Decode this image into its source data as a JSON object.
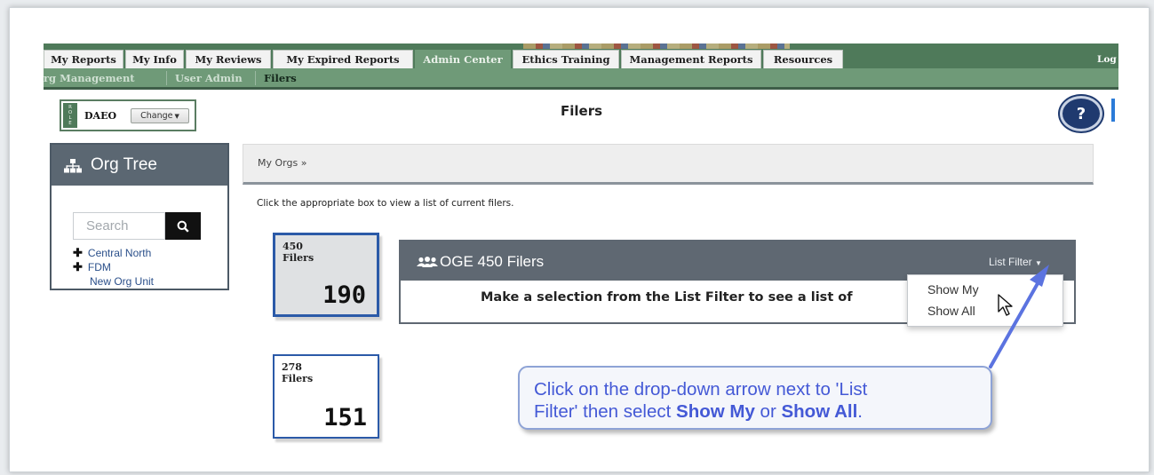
{
  "topnav": {
    "tabs": [
      {
        "label": "My Reports"
      },
      {
        "label": "My Info"
      },
      {
        "label": "My Reviews"
      },
      {
        "label": "My Expired Reports"
      },
      {
        "label": "Admin Center"
      },
      {
        "label": "Ethics Training"
      },
      {
        "label": "Management Reports"
      },
      {
        "label": "Resources"
      }
    ],
    "logout": "Log Out"
  },
  "subnav": {
    "items": [
      {
        "label": "rg Management"
      },
      {
        "label": "User Admin"
      },
      {
        "label": "Filers"
      }
    ]
  },
  "role": {
    "strip": "ROLE",
    "name": "DAEO",
    "change_label": "Change"
  },
  "page": {
    "title": "Filers",
    "help": "?"
  },
  "org_tree": {
    "title": "Org Tree",
    "search_placeholder": "Search",
    "items": [
      {
        "label": "Central North"
      },
      {
        "label": "FDM"
      },
      {
        "label": "New Org Unit"
      }
    ]
  },
  "breadcrumb": {
    "text": "My Orgs »"
  },
  "instructions": "Click the appropriate box to view a list of current filers.",
  "filer_boxes": [
    {
      "type": "450",
      "unit": "Filers",
      "count": "190"
    },
    {
      "type": "278",
      "unit": "Filers",
      "count": "151"
    }
  ],
  "panel": {
    "title": "OGE 450 Filers",
    "list_filter_label": "List Filter",
    "message": "Make a selection from the List Filter to see a list of"
  },
  "dropdown": {
    "options": [
      {
        "label": "Show My"
      },
      {
        "label": "Show All"
      }
    ]
  },
  "callout": {
    "line1": "Click on the drop-down arrow next to 'List",
    "line2_a": "Filter' then select ",
    "line2_b": "Show My",
    "line2_c": " or ",
    "line2_d": "Show All",
    "line2_e": "."
  },
  "colors": {
    "nav_green": "#4f7a5a",
    "subnav_green": "#6f9a78",
    "panel_gray": "#5f6872",
    "box_blue": "#2b5aa8",
    "callout_text": "#4459d6",
    "arrow": "#5b73e0"
  }
}
